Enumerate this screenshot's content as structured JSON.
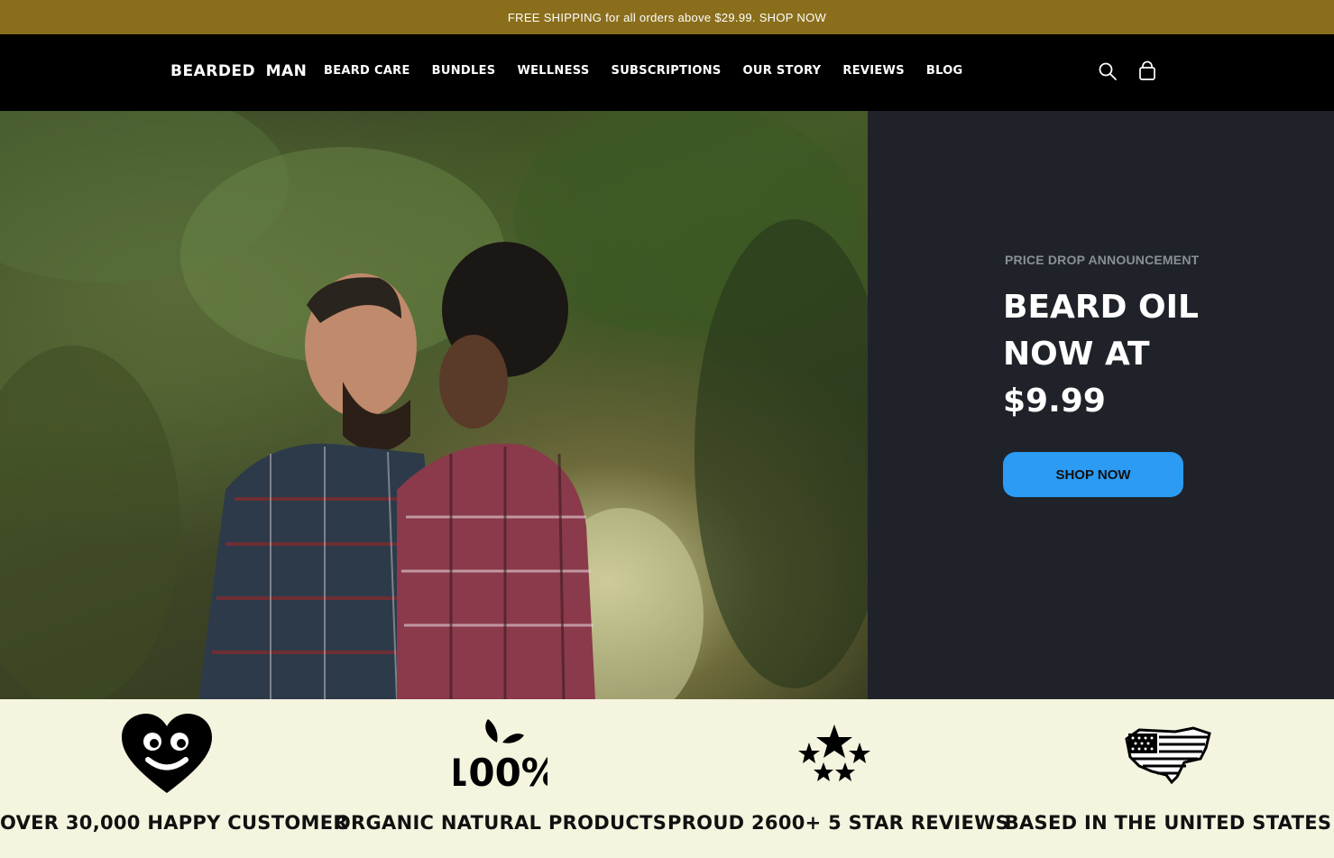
{
  "announcement": {
    "text": "FREE SHIPPING for all orders above $29.99. SHOP NOW"
  },
  "header": {
    "logo": "BEARDED MAN",
    "nav": [
      "BEARD CARE",
      "BUNDLES",
      "WELLNESS",
      "SUBSCRIPTIONS",
      "OUR STORY",
      "REVIEWS",
      "BLOG"
    ],
    "icons": {
      "search": "search-icon",
      "cart": "cart-icon"
    }
  },
  "hero": {
    "image": "couple-in-forest-photo",
    "kicker": "PRICE DROP ANNOUNCEMENT",
    "headline": "BEARD OIL NOW AT $9.99",
    "button": "SHOP NOW"
  },
  "features": [
    {
      "icon": "smiling-heart-icon",
      "label": "OVER 30,000 HAPPY CUSTOMER"
    },
    {
      "icon": "100-percent-leaf-icon",
      "label": "ORGANIC NATURAL PRODUCTS"
    },
    {
      "icon": "five-stars-icon",
      "label": "PROUD 2600+ 5 STAR REVIEWS"
    },
    {
      "icon": "usa-flag-map-icon",
      "label": "BASED IN THE UNITED STATES"
    }
  ],
  "colors": {
    "announcement_bg": "#8a6e1b",
    "header_bg": "#000000",
    "panel_bg": "#1f2329",
    "button": "#2b9bf4",
    "features_bg": "#f4f4df"
  }
}
